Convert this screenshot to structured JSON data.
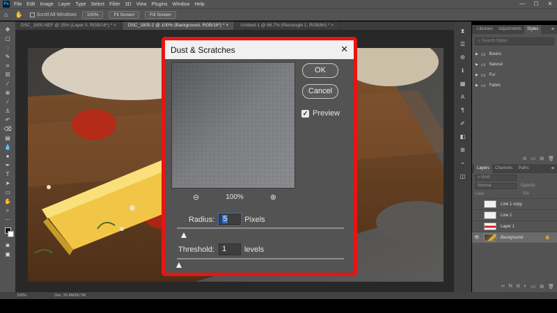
{
  "app": {
    "logo": "Ps"
  },
  "menu": [
    "File",
    "Edit",
    "Image",
    "Layer",
    "Type",
    "Select",
    "Filter",
    "3D",
    "View",
    "Plugins",
    "Window",
    "Help"
  ],
  "window_controls": [
    "—",
    "☐",
    "✕"
  ],
  "options_bar": {
    "scroll_all_label": "Scroll All Windows",
    "zoom_value": "100%",
    "fit_screen": "Fit Screen",
    "fill_screen": "Fill Screen"
  },
  "doc_tabs": [
    {
      "label": "DSC_1805.NEF @ 25% (Layer 0, RGB/16*) *  ×",
      "active": false
    },
    {
      "label": "DSC_1805-2 @ 100% (Background, RGB/16*) *  ×",
      "active": true
    },
    {
      "label": "Untitled-1 @ 66.7% (Rectangle 1, RGB/8#) *  ×",
      "active": false
    }
  ],
  "styles_panel": {
    "tabs": [
      "Libraries",
      "Adjustments",
      "Styles"
    ],
    "active_tab": "Styles",
    "search_placeholder": "Search Styles",
    "folders": [
      "Basics",
      "Natural",
      "Fur",
      "Fabric"
    ]
  },
  "layers_panel": {
    "tabs": [
      "Layers",
      "Channels",
      "Paths"
    ],
    "kind_label": "Kind",
    "blend_mode": "Normal",
    "opacity_label": "Opacity:",
    "lock_label": "Lock:",
    "fill_label": "Fill:",
    "layers": [
      {
        "name": "Line 1 copy",
        "visible": false,
        "selected": false
      },
      {
        "name": "Line 1",
        "visible": false,
        "selected": false
      },
      {
        "name": "Layer 1",
        "visible": false,
        "selected": false
      },
      {
        "name": "Background",
        "visible": true,
        "selected": true
      }
    ]
  },
  "status_bar": {
    "zoom": "100%",
    "doc_info": "Doc: 26.4M/60.7M"
  },
  "dialog": {
    "title": "Dust & Scratches",
    "close_glyph": "✕",
    "ok_label": "OK",
    "cancel_label": "Cancel",
    "preview_label": "Preview",
    "preview_checked": true,
    "zoom_percent": "100%",
    "radius_label": "Radius:",
    "radius_value": "5",
    "radius_unit": "Pixels",
    "radius_slider_fraction": 0.02,
    "threshold_label": "Threshold:",
    "threshold_value": "1",
    "threshold_unit": "levels",
    "threshold_slider_fraction": 0.0
  },
  "colors": {
    "dialog_highlight": "#e81414",
    "accent": "#2e6fcf"
  }
}
